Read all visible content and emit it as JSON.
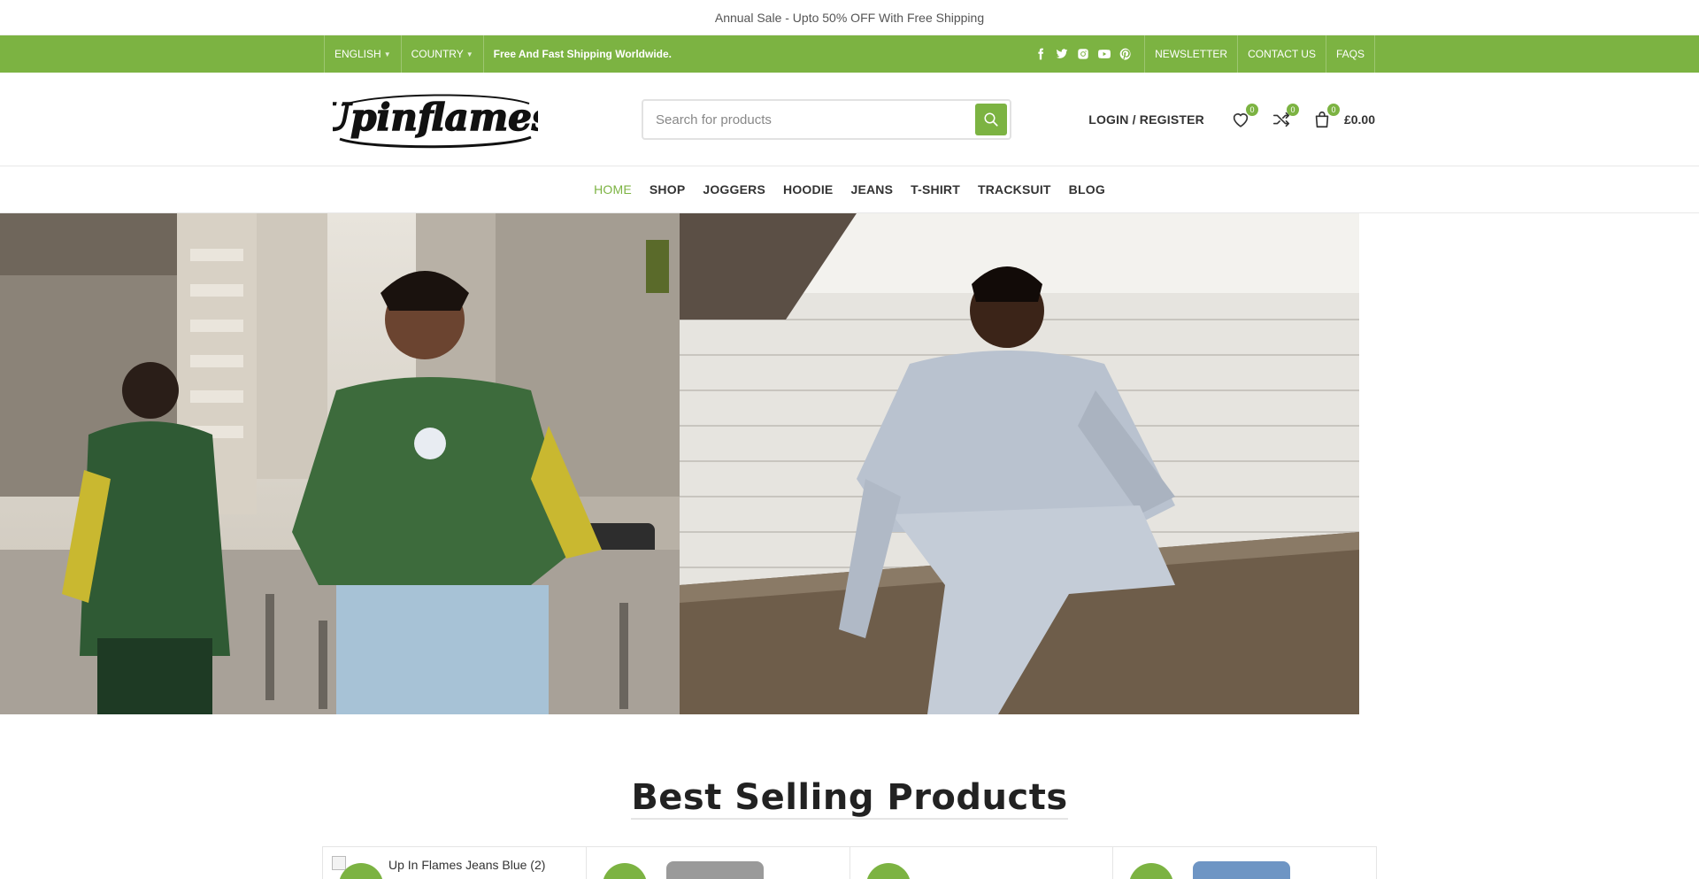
{
  "announcement": "Annual Sale - Upto 50% OFF With Free Shipping",
  "topbar": {
    "language": "ENGLISH",
    "country": "COUNTRY",
    "note": "Free And Fast Shipping Worldwide.",
    "social_icons": [
      "facebook-icon",
      "twitter-icon",
      "instagram-icon",
      "youtube-icon",
      "pinterest-icon"
    ],
    "links": [
      "NEWSLETTER",
      "CONTACT US",
      "FAQS"
    ]
  },
  "header": {
    "logo_text": "Upinflames",
    "search_placeholder": "Search for products",
    "login": "LOGIN / REGISTER",
    "wishlist_count": "0",
    "compare_count": "0",
    "cart_count": "0",
    "cart_total": "£0.00"
  },
  "nav": {
    "items": [
      "HOME",
      "SHOP",
      "JOGGERS",
      "HOODIE",
      "JEANS",
      "T-SHIRT",
      "TRACKSUIT",
      "BLOG"
    ],
    "active": "HOME"
  },
  "section": {
    "title": "Best Selling Products"
  },
  "products": [
    {
      "image_alt": "Up In Flames Jeans Blue (2)"
    },
    {
      "image_alt": ""
    },
    {
      "image_alt": ""
    },
    {
      "image_alt": ""
    }
  ],
  "colors": {
    "accent": "#7cb342",
    "text": "#333333"
  }
}
